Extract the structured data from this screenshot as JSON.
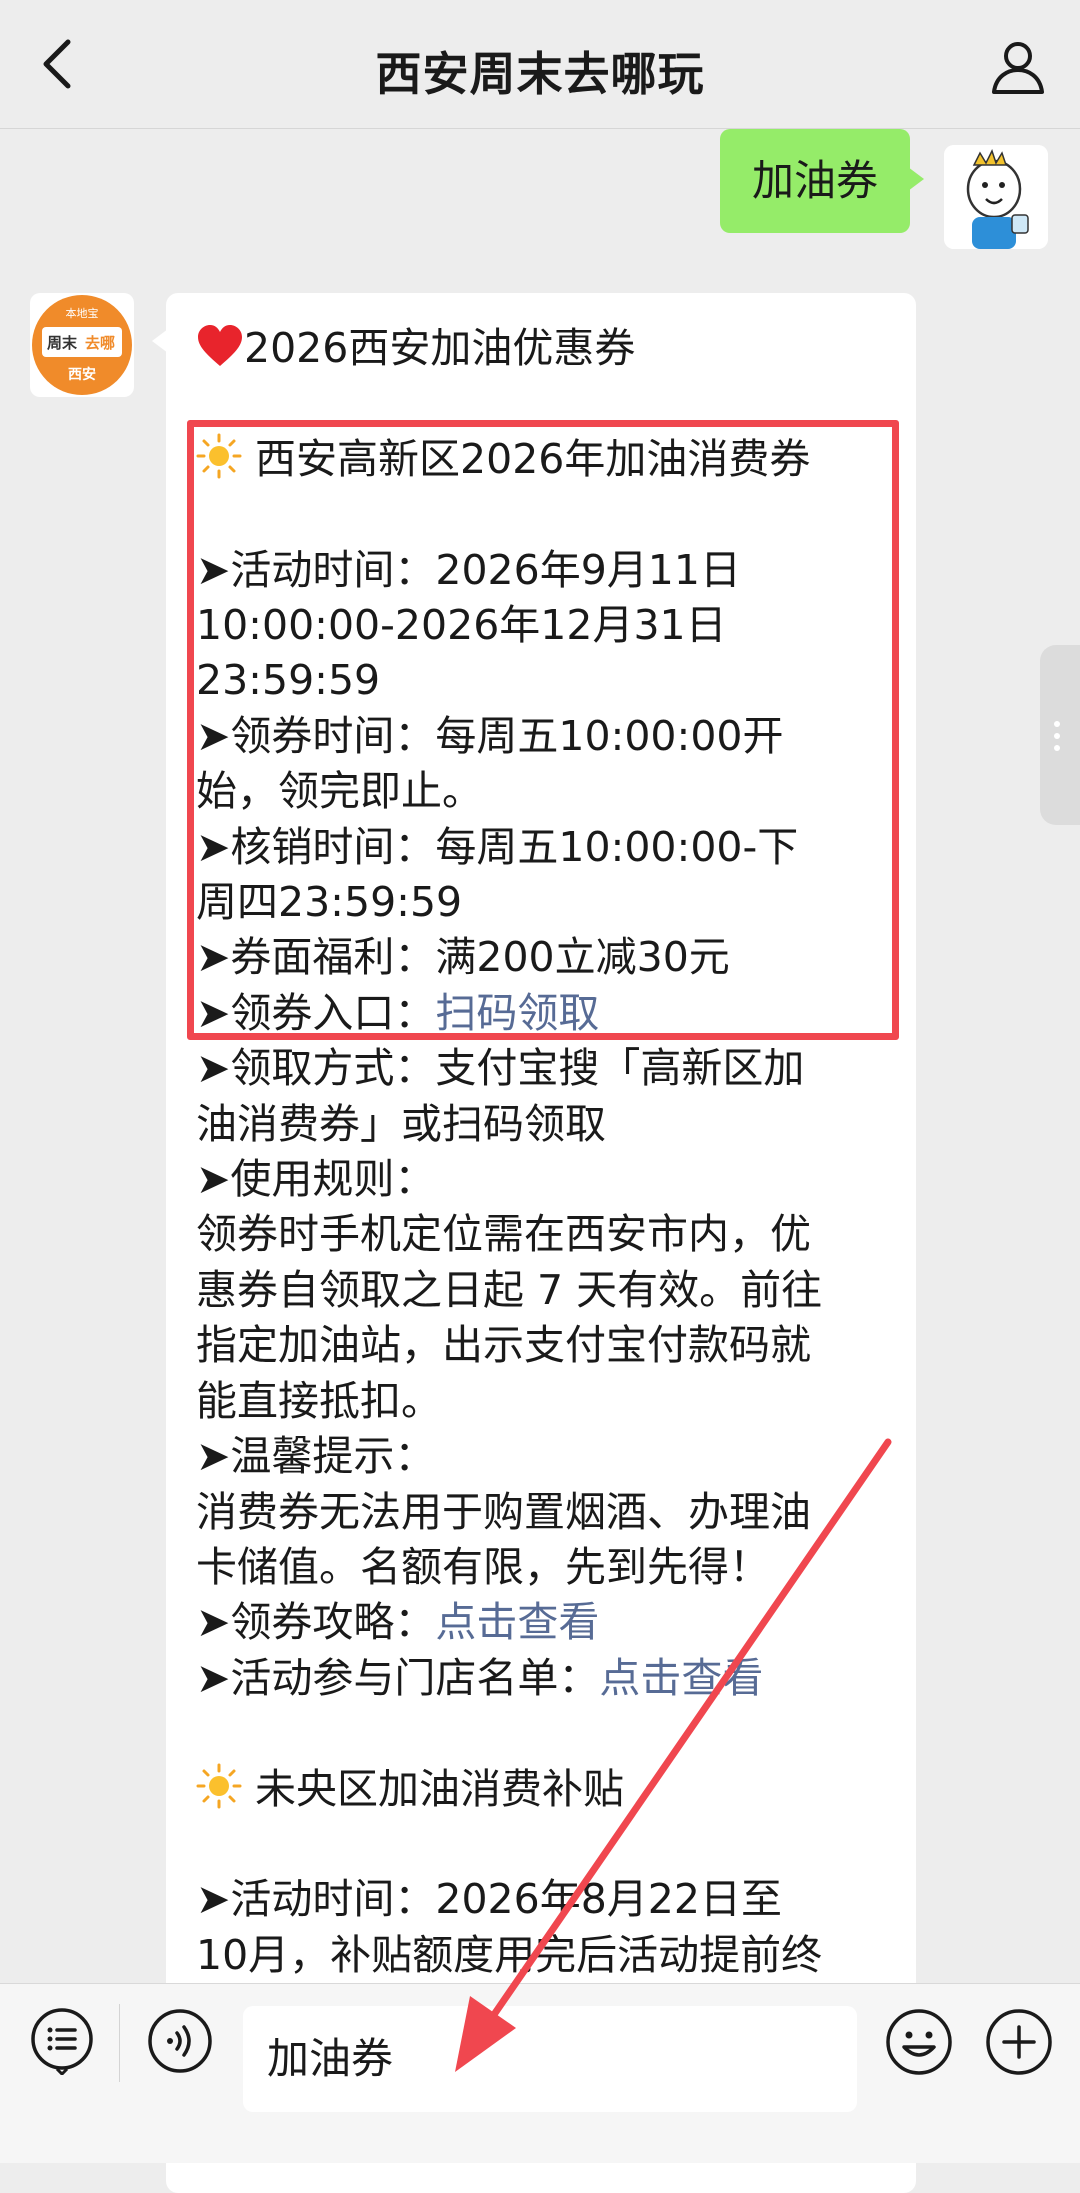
{
  "header": {
    "title": "西安周末去哪玩"
  },
  "my_message": {
    "text": "加油券"
  },
  "bot_avatar": {
    "top": "本地宝",
    "middle_a": "周末",
    "middle_b": "去哪",
    "bottom": "西安"
  },
  "bot_message": {
    "title": "2026西安加油优惠券",
    "lines": [
      " 西安高新区2026年加油消费券",
      "",
      "➤活动时间：2026年9月11日",
      "10:00:00-2026年12月31日",
      "23:59:59",
      "➤领券时间：每周五10:00:00开",
      "始，领完即止。",
      "➤核销时间：每周五10:00:00-下",
      "周四23:59:59",
      "➤券面福利：满200立减30元",
      "➤领券入口：",
      "➤领取方式：支付宝搜「高新区加",
      "油消费券」或扫码领取",
      "➤使用规则：",
      "领券时手机定位需在西安市内，优",
      "惠券自领取之日起 7 天有效。前往",
      "指定加油站，出示支付宝付款码就",
      "能直接抵扣。",
      "➤温馨提示：",
      "消费券无法用于购置烟酒、办理油",
      "卡储值。名额有限，先到先得！",
      "➤领券攻略：",
      "➤活动参与门店名单：",
      "",
      " 未央区加油消费补贴",
      "",
      "➤活动时间：2026年8月22日至",
      "10月，补贴额度用完后活动提前终"
    ],
    "links": {
      "entry": "扫码领取",
      "guide": "点击查看",
      "stores": "点击查看"
    }
  },
  "input": {
    "value": "加油券"
  },
  "colors": {
    "bubble_green": "#95ec69",
    "link": "#576b95",
    "highlight": "#f0474f"
  }
}
